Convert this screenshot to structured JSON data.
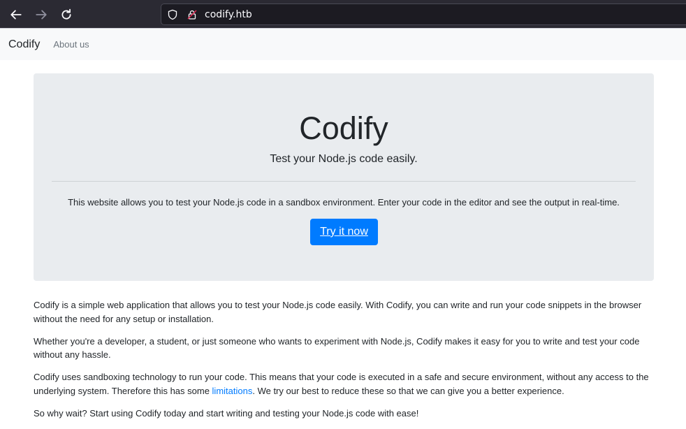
{
  "browser": {
    "url": "codify.htb"
  },
  "navbar": {
    "brand": "Codify",
    "links": [
      "About us"
    ]
  },
  "hero": {
    "title": "Codify",
    "lead": "Test your Node.js code easily.",
    "description": "This website allows you to test your Node.js code in a sandbox environment. Enter your code in the editor and see the output in real-time.",
    "cta_label": "Try it now"
  },
  "content": {
    "p1": "Codify is a simple web application that allows you to test your Node.js code easily. With Codify, you can write and run your code snippets in the browser without the need for any setup or installation.",
    "p2": "Whether you're a developer, a student, or just someone who wants to experiment with Node.js, Codify makes it easy for you to write and test your code without any hassle.",
    "p3_before": "Codify uses sandboxing technology to run your code. This means that your code is executed in a safe and secure environment, without any access to the underlying system. Therefore this has some ",
    "p3_link": "limitations",
    "p3_after": ". We try our best to reduce these so that we can give you a better experience.",
    "p4": "So why wait? Start using Codify today and start writing and testing your Node.js code with ease!"
  },
  "icons": {
    "back": "arrow-left-icon",
    "forward": "arrow-right-icon",
    "reload": "reload-icon",
    "shield": "shield-icon",
    "lock": "lock-insecure-icon"
  },
  "colors": {
    "primary": "#007bff",
    "jumbotron_bg": "#e9ecef",
    "navbar_bg": "#f8f9fa"
  }
}
